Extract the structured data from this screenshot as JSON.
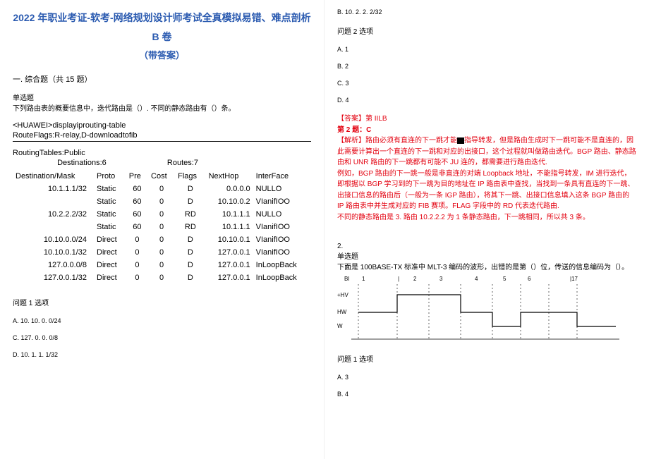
{
  "title_line1": "2022 年职业考证-软考-网络规划设计师考试全真模拟易错、难点剖析 B 卷",
  "title_line2": "（带答案）",
  "section": "一. 综合题（共 15 题）",
  "q1": {
    "type": "单选题",
    "text": "下列路由表的概要信息中，迭代路由是（）. 不同的静态路由有（）条。",
    "cli1": "<HUAWEI>displayiprouting-table",
    "cli2": "RouteFlags:R-relay,D-downloadtofib",
    "rt1": "RoutingTables:Public",
    "rt2a": "Destinations:6",
    "rt2b": "Routes:7",
    "headers": [
      "Destination/Mask",
      "Proto",
      "Pre",
      "Cost",
      "Flags",
      "NextHop",
      "InterFace"
    ],
    "rows": [
      [
        "10.1.1.1/32",
        "Static",
        "60",
        "0",
        "D",
        "0.0.0.0",
        "NULLO"
      ],
      [
        "",
        "Static",
        "60",
        "0",
        "D",
        "10.10.0.2",
        "VIanifIOO"
      ],
      [
        "10.2.2.2/32",
        "Static",
        "60",
        "0",
        "RD",
        "10.1.1.1",
        "NULLO"
      ],
      [
        "",
        "Static",
        "60",
        "0",
        "RD",
        "10.1.1.1",
        "VIanifIOO"
      ],
      [
        "10.10.0.0/24",
        "Direct",
        "0",
        "0",
        "D",
        "10.10.0.1",
        "VIanifIOO"
      ],
      [
        "10.10.0.1/32",
        "Direct",
        "0",
        "0",
        "D",
        "127.0.0.1",
        "VIanifIOO"
      ],
      [
        "127.0.0.0/8",
        "Direct",
        "0",
        "0",
        "D",
        "127.0.0.1",
        "InLoopBack"
      ],
      [
        "127.0.0.1/32",
        "Direct",
        "0",
        "0",
        "D",
        "127.0.0.1",
        "InLoopBack"
      ]
    ],
    "opt1_label": "问题 1 选项",
    "opt1": {
      "A": "A. 10. 10. 0. 0/24",
      "C": "C.    127. 0. 0. 0/8",
      "D": "D.    10. 1. 1. 1/32",
      "B": "B. 10. 2. 2. 2/32"
    },
    "opt2_label": "问题 2 选项",
    "opt2": {
      "A": "A.    1",
      "B": "B.    2",
      "C": "C.    3",
      "D": "D. 4"
    }
  },
  "answer": {
    "head": "【答案】第 IILB",
    "line1": "第 2 题：C",
    "line2_a": "【解析】路由必须有直连的下一跳才能",
    "line2_b": "指导转发，但是路由生成时下一跳可能不是直连的，因此需要计算出一个直连的下一跳和对应的出接口，这个过程就叫做路由迭代。BGP 路由、静态路由和 UNR 路由的下一跳都有可能不 JU 连的，都需要进行路由迭代.",
    "line3": "例如，BGP 路由的下一跳一般是非直连的对端 Loopback 地址，不能指号转发，IM 进行迭代，即根据以 BGP 学习到的下一跳为目的地址在 IP 路由表中查找，当找到一条具有直连的下一跳、出接口信息的路由后（一般为一条 IGP 路由），将其下一跳、出接口信息填入这条 BGP 路由的 IP 路由表中并生成对应的 FIB 赛项。FLAG 字段中的 RD 代表迭代路由.",
    "line4": "不同的静态路由是 3. 路由 10.2.2.2 为 1 条静态路由，下一跳相同，所以共 3 条。"
  },
  "q2": {
    "num": "2.",
    "type": "单选题",
    "text": "下面是 100BASE-TX 标准中 MLT-3 编码的波形，出错的是第（）位，传送的信息编码为（）。",
    "bits_label": "1             |    2       3           4         5        6            |17",
    "lvl_hv": "+HV",
    "lvl_hw": "HW",
    "lvl_w": "W",
    "opt1_label": "问题 1 选项",
    "opt1": {
      "A": "A.    3",
      "B": "B.    4"
    }
  }
}
